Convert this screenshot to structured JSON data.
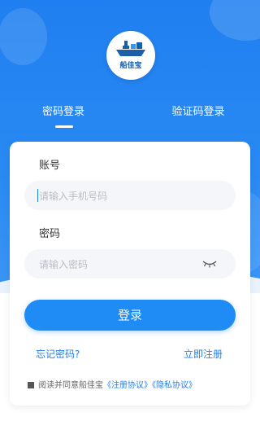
{
  "app": {
    "logo_text": "船佳宝"
  },
  "tabs": [
    {
      "label": "密码登录",
      "active": true
    },
    {
      "label": "验证码登录",
      "active": false
    }
  ],
  "form": {
    "account_label": "账号",
    "phone_placeholder": "请输入手机号码",
    "phone_value": "",
    "password_label": "密码",
    "password_placeholder": "请输入密码",
    "password_value": "",
    "eye_icon": "eye-closed-icon",
    "login_button": "登录",
    "forgot_link": "忘记密码?",
    "register_link": "立即注册"
  },
  "agreement": {
    "prefix": "阅读并同意船佳宝",
    "terms_link": "《注册协议》",
    "privacy_link": "《隐私协议》",
    "checked": false
  },
  "colors": {
    "primary": "#1f7ff0",
    "button": "#1f8bf5",
    "background_top": "#1f7ff0"
  }
}
